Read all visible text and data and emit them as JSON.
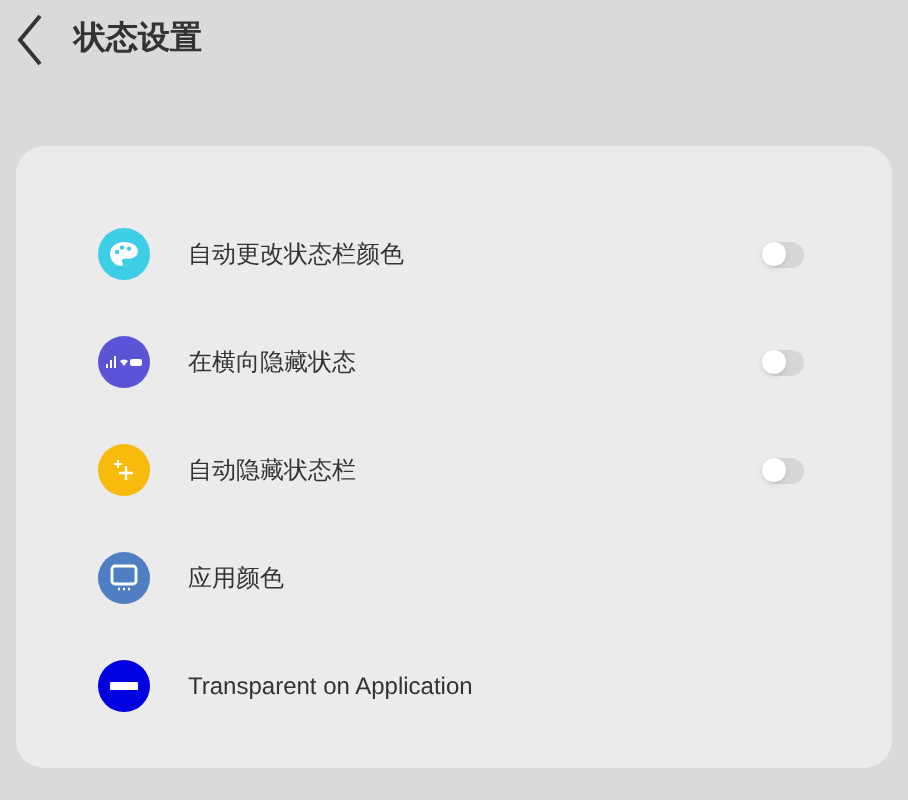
{
  "header": {
    "title": "状态设置"
  },
  "items": [
    {
      "label": "自动更改状态栏颜色",
      "kind": "toggle",
      "on": false,
      "color": "#3dcde6"
    },
    {
      "label": "在横向隐藏状态",
      "kind": "toggle",
      "on": false,
      "color": "#5b54d6"
    },
    {
      "label": "自动隐藏状态栏",
      "kind": "toggle",
      "on": false,
      "color": "#f8bb0c"
    },
    {
      "label": "应用颜色",
      "kind": "plain",
      "color": "#4f7fc2"
    },
    {
      "label": "Transparent on Application",
      "kind": "plain",
      "color": "#0000e0"
    }
  ]
}
